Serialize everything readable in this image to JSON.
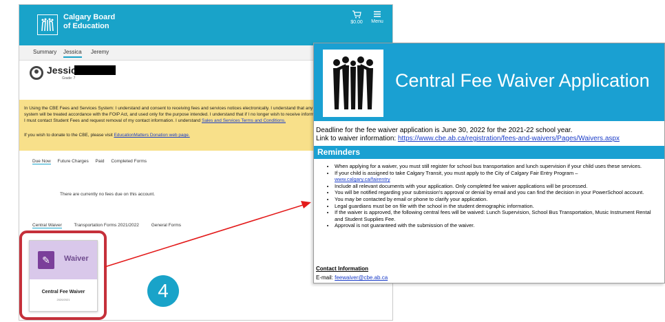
{
  "portal": {
    "brand_line1": "Calgary Board",
    "brand_line2": "of Education",
    "cart_amount": "$0.00",
    "menu_label": "Menu",
    "tabs": [
      "Summary",
      "Jessica",
      "Jeremy"
    ],
    "student_name": "Jessica",
    "student_grade": "Grade: 7",
    "notice_text": "In Using the CBE Fees and Services System: I understand and consent to receiving fees and services notices electronically. I understand that any personal information provided in this system will be treated accordance with the FOIP Act, and used only for the purpose intended. I understand that if I no longer wish to receive information electronically from this system, I must contact Student Fees and request removal of my contact information. I understand",
    "notice_link": "Sales and Services Terms and Conditions.",
    "donate_text": "If you wish to donate to the CBE, please visit",
    "donate_link": "EducationMatters Donation web page.",
    "fee_tabs": [
      "Due Now",
      "Future Charges",
      "Paid",
      "Completed Forms"
    ],
    "no_fees_text": "There are currently no fees due on this account.",
    "form_tabs": [
      "Central Waiver",
      "Transportation Forms 2021/2022",
      "General Forms"
    ],
    "card_label": "Waiver",
    "card_title": "Central Fee Waiver",
    "card_sub": "2020/2021",
    "step_number": "4"
  },
  "waiver_doc": {
    "title": "Central Fee Waiver Application",
    "deadline_text": "Deadline for the fee waiver application is June 30, 2022 for the 2021-22 school year.",
    "link_prefix": "Link to waiver information: ",
    "link_url": "https://www.cbe.ab.ca/registration/fees-and-waivers/Pages/Waivers.aspx",
    "reminders_heading": "Reminders",
    "reminders": [
      "When applying for a waiver, you must still register for school bus transportation and lunch supervision if your child uses these services.",
      "If your child is assigned to take Calgary Transit, you must apply to the City of Calgary Fair Entry Program –",
      "Include all relevant documents with your application. Only completed fee waiver applications will be processed.",
      "You will be notified regarding your submission's approval or denial by email and you can find the decision in your PowerSchool account.",
      "You may be contacted by email or phone to clarify your application.",
      "Legal guardians must be on file with the school in the student demographic information.",
      "If the waiver is approved, the following central fees will be waived: Lunch Supervision, School Bus Transportation, Music Instrument Rental and Student Supplies Fee.",
      "Approval is not guaranteed with the submission of the waiver."
    ],
    "fair_entry_link": "www.calgary.ca/fairentry",
    "contact_heading": "Contact Information",
    "contact_email_label": "E-mail: ",
    "contact_email": "feewaiver@cbe.ab.ca"
  },
  "colors": {
    "accent": "#19a3c9",
    "highlight_border": "#c5303a",
    "arrow": "#e31b1b",
    "notice_bg": "#f8e08a"
  }
}
